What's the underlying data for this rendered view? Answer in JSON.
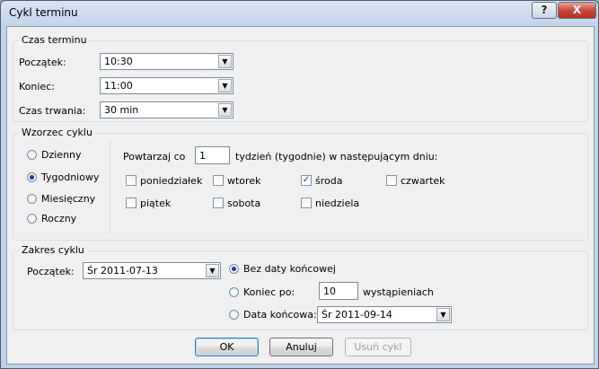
{
  "window": {
    "title": "Cykl terminu",
    "help": "?",
    "close": "X"
  },
  "time_group": {
    "legend": "Czas terminu",
    "start_label": "Początek:",
    "start_value": "10:30",
    "end_label": "Koniec:",
    "end_value": "11:00",
    "duration_label": "Czas trwania:",
    "duration_value": "30 min"
  },
  "pattern_group": {
    "legend": "Wzorzec cyklu",
    "options": [
      "Dzienny",
      "Tygodniowy",
      "Miesięczny",
      "Roczny"
    ],
    "selected": "Tygodniowy",
    "repeat_label": "Powtarzaj co",
    "repeat_value": "1",
    "repeat_suffix": "tydzień (tygodnie) w następującym dniu:",
    "days": [
      {
        "label": "poniedziałek",
        "checked": false
      },
      {
        "label": "wtorek",
        "checked": false
      },
      {
        "label": "środa",
        "checked": true
      },
      {
        "label": "czwartek",
        "checked": false
      },
      {
        "label": "piątek",
        "checked": false
      },
      {
        "label": "sobota",
        "checked": false
      },
      {
        "label": "niedziela",
        "checked": false
      }
    ]
  },
  "range_group": {
    "legend": "Zakres cyklu",
    "start_label": "Początek:",
    "start_value": "Śr 2011-07-13",
    "no_end_label": "Bez daty końcowej",
    "end_after_label": "Koniec po:",
    "end_after_value": "10",
    "end_after_suffix": "wystąpieniach",
    "end_date_label": "Data końcowa:",
    "end_date_value": "Śr 2011-09-14",
    "selected": "Bez daty końcowej"
  },
  "buttons": {
    "ok": "OK",
    "cancel": "Anuluj",
    "remove": "Usuń cykl"
  },
  "icons": {
    "dropdown": "▼",
    "checkmark": "✓"
  }
}
